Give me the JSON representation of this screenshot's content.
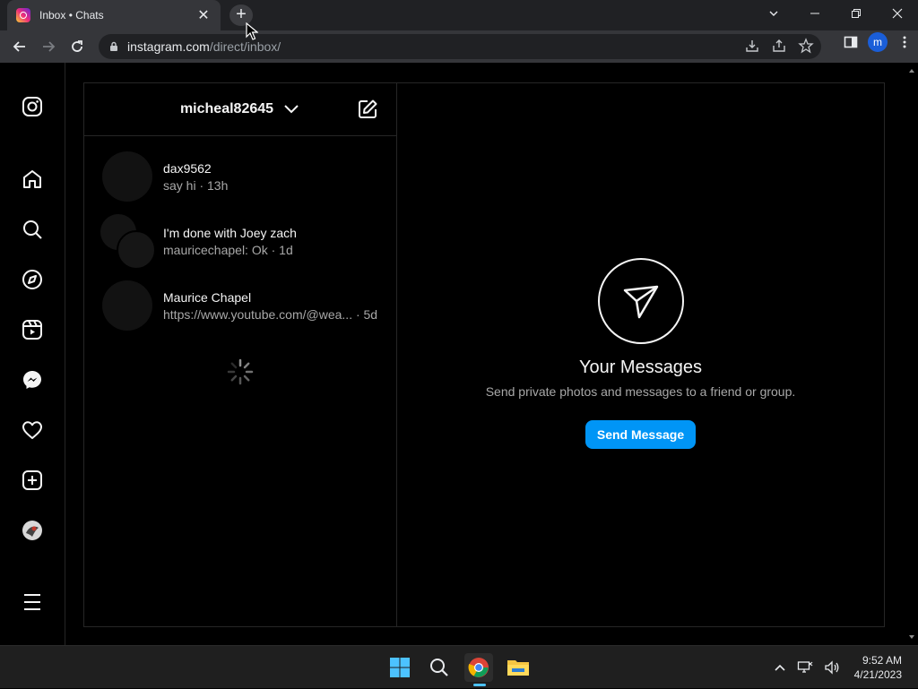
{
  "browser": {
    "tab_title": "Inbox • Chats",
    "tab_close": "✕",
    "new_tab": "+",
    "url_host": "instagram.com",
    "url_path": "/direct/inbox/",
    "profile_initial": "m"
  },
  "inbox": {
    "username": "micheal82645",
    "threads": [
      {
        "name": "dax9562",
        "preview": "say hi · 13h"
      },
      {
        "name": "I'm done with Joey zach",
        "preview": "mauricechapel: Ok · 1d"
      },
      {
        "name": "Maurice Chapel",
        "preview": "https://www.youtube.com/@wea... · 5d"
      }
    ]
  },
  "empty_state": {
    "title": "Your Messages",
    "subtitle": "Send private photos and messages to a friend or group.",
    "button_label": "Send Message"
  },
  "taskbar": {
    "time": "9:52 AM",
    "date": "4/21/2023"
  },
  "colors": {
    "accent": "#0095f6",
    "background": "#000000"
  }
}
